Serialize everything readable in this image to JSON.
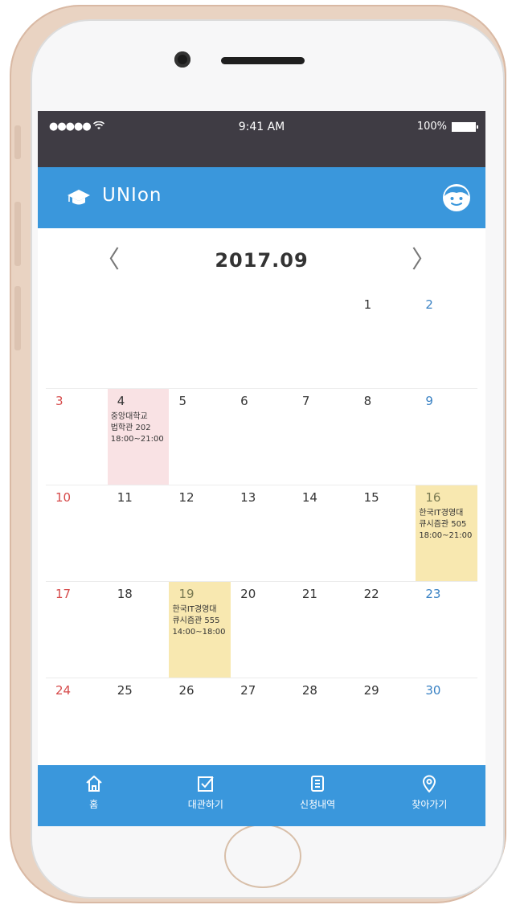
{
  "status_bar": {
    "signal": "●●●●● ",
    "time": "9:41 AM",
    "battery": "100%"
  },
  "app": {
    "title": "UNIon"
  },
  "calendar": {
    "month_label": "2017.09",
    "prev_symbol": "〈",
    "next_symbol": "〉",
    "weeks": [
      {
        "days": [
          {
            "num": "",
            "kind": "sun"
          },
          {
            "num": ""
          },
          {
            "num": ""
          },
          {
            "num": ""
          },
          {
            "num": ""
          },
          {
            "num": "1"
          },
          {
            "num": "2",
            "kind": "sat"
          }
        ]
      },
      {
        "days": [
          {
            "num": "3",
            "kind": "sun"
          },
          {
            "num": "4",
            "highlight": "pink",
            "event": [
              "중앙대학교",
              "법학관 202",
              "18:00~21:00"
            ]
          },
          {
            "num": "5"
          },
          {
            "num": "6"
          },
          {
            "num": "7"
          },
          {
            "num": "8"
          },
          {
            "num": "9",
            "kind": "sat"
          }
        ]
      },
      {
        "days": [
          {
            "num": "10",
            "kind": "sun"
          },
          {
            "num": "11"
          },
          {
            "num": "12"
          },
          {
            "num": "13"
          },
          {
            "num": "14"
          },
          {
            "num": "15"
          },
          {
            "num": "16",
            "kind": "sat",
            "highlight": "yellow",
            "event": [
              "한국IT경영대",
              "큐시즘관 505",
              "18:00~21:00"
            ]
          }
        ]
      },
      {
        "days": [
          {
            "num": "17",
            "kind": "sun"
          },
          {
            "num": "18"
          },
          {
            "num": "19",
            "highlight": "yellow",
            "event": [
              "한국IT경영대",
              "큐시즘관 555",
              "14:00~18:00"
            ]
          },
          {
            "num": "20"
          },
          {
            "num": "21"
          },
          {
            "num": "22"
          },
          {
            "num": "23",
            "kind": "sat"
          }
        ]
      },
      {
        "days": [
          {
            "num": "24",
            "kind": "sun"
          },
          {
            "num": "25"
          },
          {
            "num": "26"
          },
          {
            "num": "27"
          },
          {
            "num": "28"
          },
          {
            "num": "29"
          },
          {
            "num": "30",
            "kind": "sat"
          }
        ]
      }
    ]
  },
  "bottom_nav": {
    "home": "홈",
    "reserve": "대관하기",
    "history": "신청내역",
    "directions": "찾아가기"
  },
  "colors": {
    "primary": "#3a97dc",
    "status_bar": "#3f3c44",
    "pink": "#f9e2e4",
    "yellow": "#f8e8b0"
  }
}
